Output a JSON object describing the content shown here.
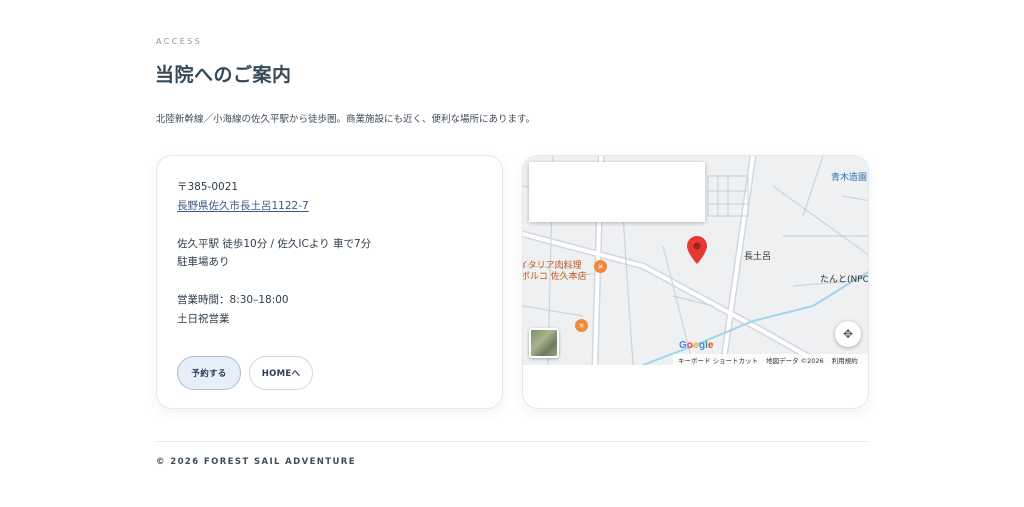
{
  "section": {
    "eyebrow": "ACCESS",
    "title": "当院へのご案内",
    "lead": "北陸新幹線／小海線の佐久平駅から徒歩圏。商業施設にも近く、便利な場所にあります。"
  },
  "info": {
    "postal": "〒385-0021",
    "address": "長野県佐久市長土呂1122-7",
    "access": "佐久平駅 徒歩10分 / 佐久ICより 車で7分",
    "parking": "駐車場あり",
    "hours": "営業時間：8:30–18:00",
    "holidays": "土日祝営業"
  },
  "buttons": {
    "reserve": "予約する",
    "home": "HOMEへ"
  },
  "map": {
    "labels": {
      "aoki": "青木造園",
      "nagatoro": "長土呂",
      "tando": "たんと(NPO",
      "restaurant_line1": "イタリア肉料理",
      "restaurant_line2": "ボルコ 佐久本店"
    },
    "google": "Google",
    "attribution": {
      "shortcuts": "キーボード ショートカット",
      "data": "地図データ ©2026",
      "terms": "利用規約"
    },
    "colors": {
      "pin": "#e53935",
      "river": "#9fd4ef",
      "poi": "#f08a3a"
    }
  },
  "footer": {
    "copyright": "© 2026 FOREST SAIL ADVENTURE"
  }
}
